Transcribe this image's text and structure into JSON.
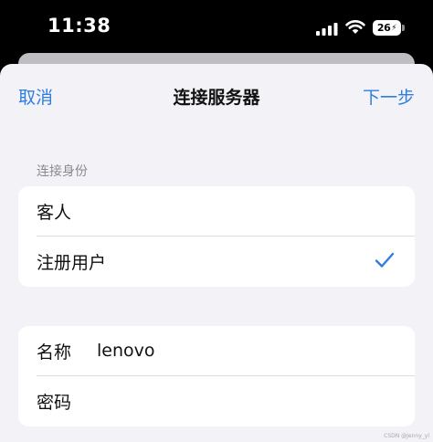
{
  "status_bar": {
    "time": "11:38",
    "battery_level": "26",
    "signal_icon": "cellular-signal-icon",
    "wifi_icon": "wifi-icon",
    "battery_charging": true
  },
  "nav": {
    "cancel_label": "取消",
    "title": "连接服务器",
    "next_label": "下一步"
  },
  "identity_section": {
    "header": "连接身份",
    "options": [
      {
        "label": "客人",
        "selected": false
      },
      {
        "label": "注册用户",
        "selected": true
      }
    ],
    "check_icon": "checkmark-icon"
  },
  "credentials_section": {
    "name_label": "名称",
    "name_value": "lenovo",
    "password_label": "密码",
    "password_value": ""
  },
  "watermark": "CSDN @Jenny_yl",
  "colors": {
    "accent": "#2f7de1",
    "background": "#f2f2f7",
    "card": "#ffffff",
    "secondary_text": "#8a8a8e"
  }
}
